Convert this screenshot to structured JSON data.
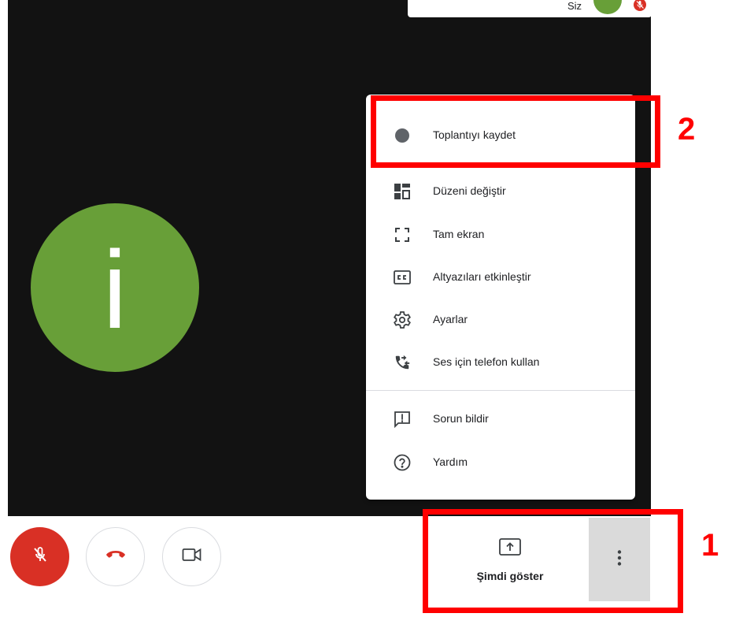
{
  "self_tile": {
    "you_label": "Siz"
  },
  "participant": {
    "initial": "i",
    "color": "#689f38"
  },
  "menu": {
    "items": [
      {
        "icon": "record-dot-icon",
        "label": "Toplantıyı kaydet"
      },
      {
        "icon": "layout-icon",
        "label": "Düzeni değiştir"
      },
      {
        "icon": "fullscreen-icon",
        "label": "Tam ekran"
      },
      {
        "icon": "captions-icon",
        "label": "Altyazıları etkinleştir"
      },
      {
        "icon": "settings-gear-icon",
        "label": "Ayarlar"
      },
      {
        "icon": "phone-forward-icon",
        "label": "Ses için telefon kullan"
      },
      {
        "icon": "feedback-icon",
        "label": "Sorun bildir"
      },
      {
        "icon": "help-icon",
        "label": "Yardım"
      }
    ]
  },
  "annotations": [
    {
      "number": "1",
      "color": "#ff0000"
    },
    {
      "number": "2",
      "color": "#ff0000"
    }
  ],
  "controls": {
    "mic_state": "muted",
    "present_label": "Şimdi göster"
  },
  "colors": {
    "accent_red": "#d93025",
    "annotation_red": "#ff0000",
    "video_bg": "#121212"
  }
}
